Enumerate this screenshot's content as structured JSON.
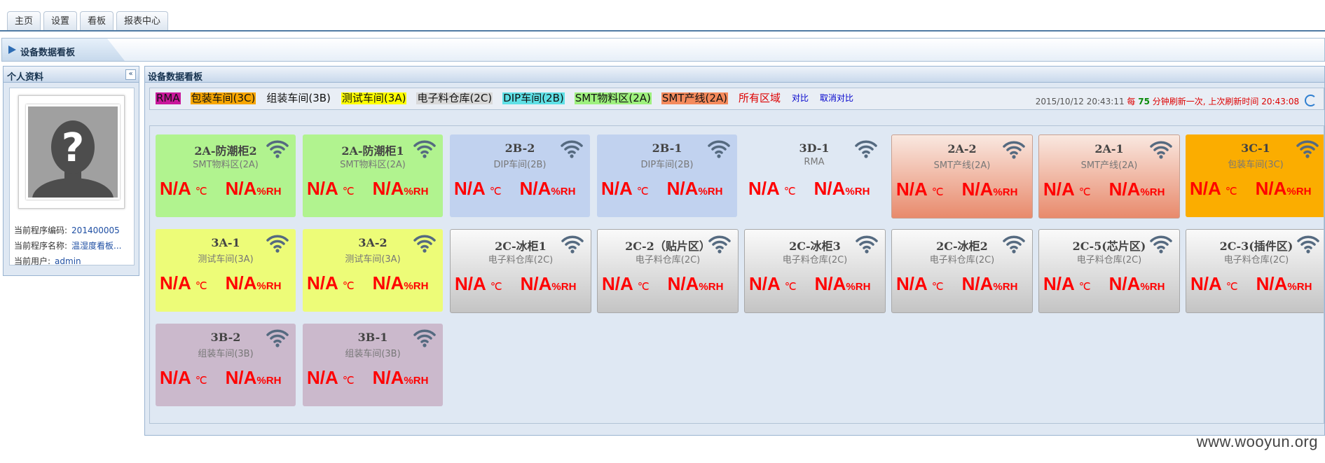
{
  "tabs": [
    "主页",
    "设置",
    "看板",
    "报表中心"
  ],
  "page_title": "设备数据看板",
  "left_panel": {
    "title": "个人资料",
    "collapse_glyph": "«",
    "info": [
      {
        "label": "当前程序编码:",
        "value": "201400005"
      },
      {
        "label": "当前程序名称:",
        "value": "温湿度看板..."
      },
      {
        "label": "当前用户:",
        "value": "admin"
      }
    ]
  },
  "main_panel": {
    "title": "设备数据看板",
    "filters": [
      {
        "label": "RMA",
        "bg": "#c9179b"
      },
      {
        "label": "包装车间(3C)",
        "bg": "#f7a600"
      },
      {
        "label": "组装车间(3B)",
        "bg": ""
      },
      {
        "label": "测试车间(3A)",
        "bg": "#ffff00"
      },
      {
        "label": "电子料仓库(2C)",
        "bg": "#d9d9d9"
      },
      {
        "label": "DIP车间(2B)",
        "bg": "#5fe0e6"
      },
      {
        "label": "SMT物料区(2A)",
        "bg": "#9ef17e"
      },
      {
        "label": "SMT产线(2A)",
        "bg": "#f48a5c"
      },
      {
        "label": "所有区域",
        "bg": ""
      },
      {
        "label": "对比",
        "bg": ""
      },
      {
        "label": "取消对比",
        "bg": ""
      }
    ],
    "status": {
      "datetime": "2015/10/12  20:43:11",
      "every": "每",
      "minutes": "75",
      "text": "分钟刷新一次, 上次刷新时间",
      "last_time": "20:43:08"
    },
    "temp_unit": "℃",
    "hum_unit": "%RH",
    "cards": [
      {
        "name": "2A-防潮柜2",
        "area": "SMT物料区(2A)",
        "temp": "N/A",
        "hum": "N/A",
        "color": "#b1f38f"
      },
      {
        "name": "2A-防潮柜1",
        "area": "SMT物料区(2A)",
        "temp": "N/A",
        "hum": "N/A",
        "color": "#b1f38f"
      },
      {
        "name": "2B-2",
        "area": "DIP车间(2B)",
        "temp": "N/A",
        "hum": "N/A",
        "color": "#c1d2ef"
      },
      {
        "name": "2B-1",
        "area": "DIP车间(2B)",
        "temp": "N/A",
        "hum": "N/A",
        "color": "#c1d2ef"
      },
      {
        "name": "3D-1",
        "area": "RMA",
        "temp": "N/A",
        "hum": "N/A",
        "color": "#dfe8f3"
      },
      {
        "name": "2A-2",
        "area": "SMT产线(2A)",
        "temp": "N/A",
        "hum": "N/A",
        "color": "gradient-salmon"
      },
      {
        "name": "2A-1",
        "area": "SMT产线(2A)",
        "temp": "N/A",
        "hum": "N/A",
        "color": "gradient-salmon"
      },
      {
        "name": "3C-1",
        "area": "包装车间(3C)",
        "temp": "N/A",
        "hum": "N/A",
        "color": "#fbad00"
      },
      {
        "name": "3A-1",
        "area": "测试车间(3A)",
        "temp": "N/A",
        "hum": "N/A",
        "color": "#edfc78"
      },
      {
        "name": "3A-2",
        "area": "测试车间(3A)",
        "temp": "N/A",
        "hum": "N/A",
        "color": "#edfc78"
      },
      {
        "name": "2C-冰柜1",
        "area": "电子料仓库(2C)",
        "temp": "N/A",
        "hum": "N/A",
        "color": "gradient-gray"
      },
      {
        "name": "2C-2（贴片区）",
        "area": "电子料仓库(2C)",
        "temp": "N/A",
        "hum": "N/A",
        "color": "gradient-gray"
      },
      {
        "name": "2C-冰柜3",
        "area": "电子料仓库(2C)",
        "temp": "N/A",
        "hum": "N/A",
        "color": "gradient-gray"
      },
      {
        "name": "2C-冰柜2",
        "area": "电子料仓库(2C)",
        "temp": "N/A",
        "hum": "N/A",
        "color": "gradient-gray"
      },
      {
        "name": "2C-5(芯片区)",
        "area": "电子料仓库(2C)",
        "temp": "N/A",
        "hum": "N/A",
        "color": "gradient-gray"
      },
      {
        "name": "2C-3(插件区)",
        "area": "电子料仓库(2C)",
        "temp": "N/A",
        "hum": "N/A",
        "color": "gradient-gray"
      },
      {
        "name": "3B-2",
        "area": "组装车间(3B)",
        "temp": "N/A",
        "hum": "N/A",
        "color": "#cbb9cc"
      },
      {
        "name": "3B-1",
        "area": "组装车间(3B)",
        "temp": "N/A",
        "hum": "N/A",
        "color": "#cbb9cc"
      }
    ]
  },
  "watermark": "www.wooyun.org",
  "icons": {
    "card_signal": "wifi-icon",
    "avatar": "user-placeholder-icon",
    "refresh": "refresh-icon",
    "title": "arrow-icon"
  }
}
